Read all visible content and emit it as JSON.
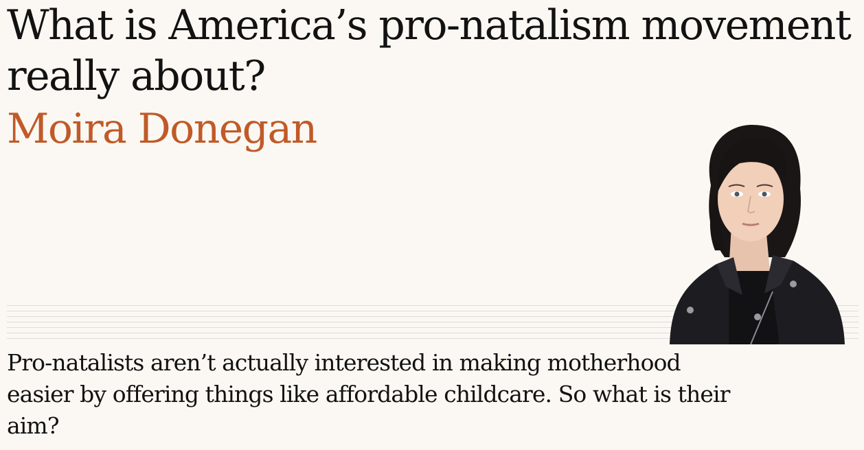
{
  "article": {
    "headline": "What is America’s pro-natalism movement really about?",
    "byline": "Moira Donegan",
    "standfirst": "Pro-natalists aren’t actually interested in making motherhood easier by offering things like affordable childcare. So what is their aim?",
    "accent_color": "#c05a28",
    "background_color": "#fbf8f3"
  }
}
